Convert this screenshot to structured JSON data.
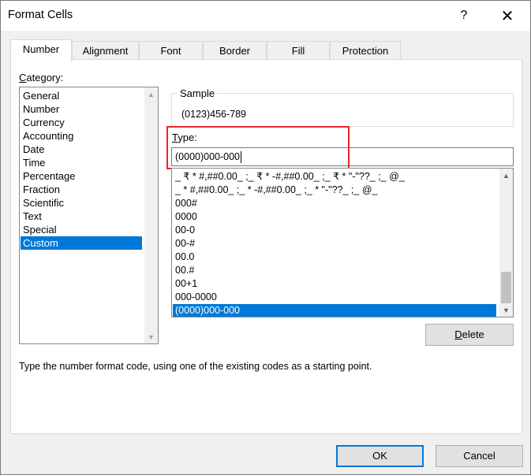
{
  "window": {
    "title": "Format Cells",
    "help_glyph": "?",
    "close_glyph": "✕"
  },
  "tabs": [
    {
      "label": "Number",
      "active": true
    },
    {
      "label": "Alignment",
      "active": false
    },
    {
      "label": "Font",
      "active": false
    },
    {
      "label": "Border",
      "active": false
    },
    {
      "label": "Fill",
      "active": false
    },
    {
      "label": "Protection",
      "active": false
    }
  ],
  "category": {
    "label_prefix": "C",
    "label_rest": "ategory:",
    "items": [
      "General",
      "Number",
      "Currency",
      "Accounting",
      "Date",
      "Time",
      "Percentage",
      "Fraction",
      "Scientific",
      "Text",
      "Special",
      "Custom"
    ],
    "selected": "Custom"
  },
  "sample": {
    "label": "Sample",
    "value": "(0123)456-789"
  },
  "type": {
    "label_prefix": "T",
    "label_rest": "ype:",
    "value": "(0000)000-000"
  },
  "formats": {
    "items": [
      "_ ₹ * #,##0.00_ ;_ ₹ * -#,##0.00_ ;_ ₹ * \"-\"??_ ;_ @_",
      "_ * #,##0.00_ ;_ * -#,##0.00_ ;_ * \"-\"??_ ;_ @_",
      "000#",
      "0000",
      "00-0",
      "00-#",
      "00.0",
      "00.#",
      "00+1",
      "000-0000",
      "(0000)000-000"
    ],
    "selected": "(0000)000-000"
  },
  "buttons": {
    "delete_prefix": "D",
    "delete_rest": "elete",
    "ok": "OK",
    "cancel": "Cancel"
  },
  "hint": "Type the number format code, using one of the existing codes as a starting point.",
  "colors": {
    "selection": "#0078d7",
    "highlight_box": "#e8262d"
  },
  "icons": {
    "scroll_up": "▲",
    "scroll_down": "▼"
  }
}
